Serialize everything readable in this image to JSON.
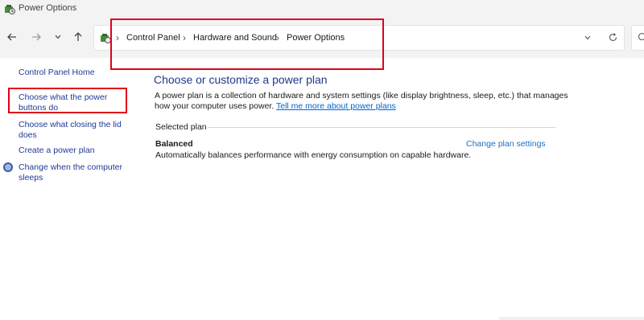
{
  "window": {
    "title": "Power Options",
    "icon": "power-options-icon"
  },
  "nav": {
    "back_icon": "back-arrow-icon",
    "forward_icon": "forward-arrow-icon",
    "recent_icon": "chevron-down-icon",
    "up_icon": "up-arrow-icon",
    "breadcrumbs": [
      "Control Panel",
      "Hardware and Sound",
      "Power Options"
    ],
    "separator": "›",
    "dropdown_icon": "chevron-down-icon",
    "refresh_icon": "refresh-icon",
    "search_icon": "search-icon"
  },
  "left_pane": {
    "links": [
      "Control Panel Home",
      "Choose what the power buttons do",
      "Choose what closing the lid does",
      "Create a power plan",
      "Change when the computer sleeps"
    ]
  },
  "main": {
    "heading": "Choose or customize a power plan",
    "description": "A power plan is a collection of hardware and system settings (like display brightness, sleep, etc.) that manages how your computer uses power.",
    "description_link": "Tell me more about power plans",
    "selected_plan_label": "Selected plan",
    "plan_name": "Balanced",
    "plan_description": "Automatically balances performance with energy consumption on capable hardware.",
    "change_plan_link": "Change plan settings"
  },
  "colors": {
    "highlight": "#e0001b",
    "link": "#1f3a93",
    "heading": "#1e3a8a"
  }
}
